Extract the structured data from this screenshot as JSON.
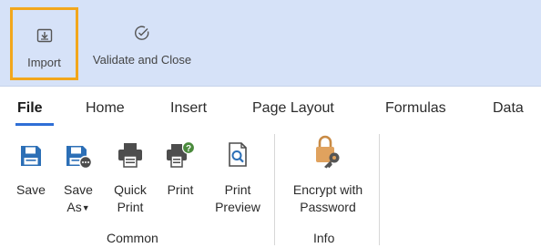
{
  "top": {
    "import_label": "Import",
    "validate_label": "Validate and Close"
  },
  "tabs": [
    "File",
    "Home",
    "Insert",
    "Page Layout",
    "Formulas",
    "Data"
  ],
  "active_tab": "File",
  "groups": {
    "common": {
      "label": "Common",
      "buttons": {
        "save": [
          "Save"
        ],
        "save_as": [
          "Save",
          "As"
        ],
        "quick_print": [
          "Quick",
          "Print"
        ],
        "print": [
          "Print"
        ],
        "print_preview": [
          "Print",
          "Preview"
        ]
      }
    },
    "info": {
      "label": "Info",
      "buttons": {
        "encrypt": [
          "Encrypt with",
          "Password"
        ]
      }
    }
  },
  "icons": {
    "import": "import-icon",
    "validate": "check-circle-icon",
    "save": "floppy-disk-icon",
    "save_as": "floppy-disk-more-icon",
    "quick_print": "printer-icon",
    "print": "printer-help-icon",
    "print_preview": "print-preview-icon",
    "encrypt": "lock-key-icon"
  },
  "colors": {
    "header_bg": "#d6e2f8",
    "highlight": "#f2a71c",
    "accent": "#2f6fd6",
    "icon_blue": "#2c6fb6",
    "lock_orange": "#e0a25e"
  }
}
